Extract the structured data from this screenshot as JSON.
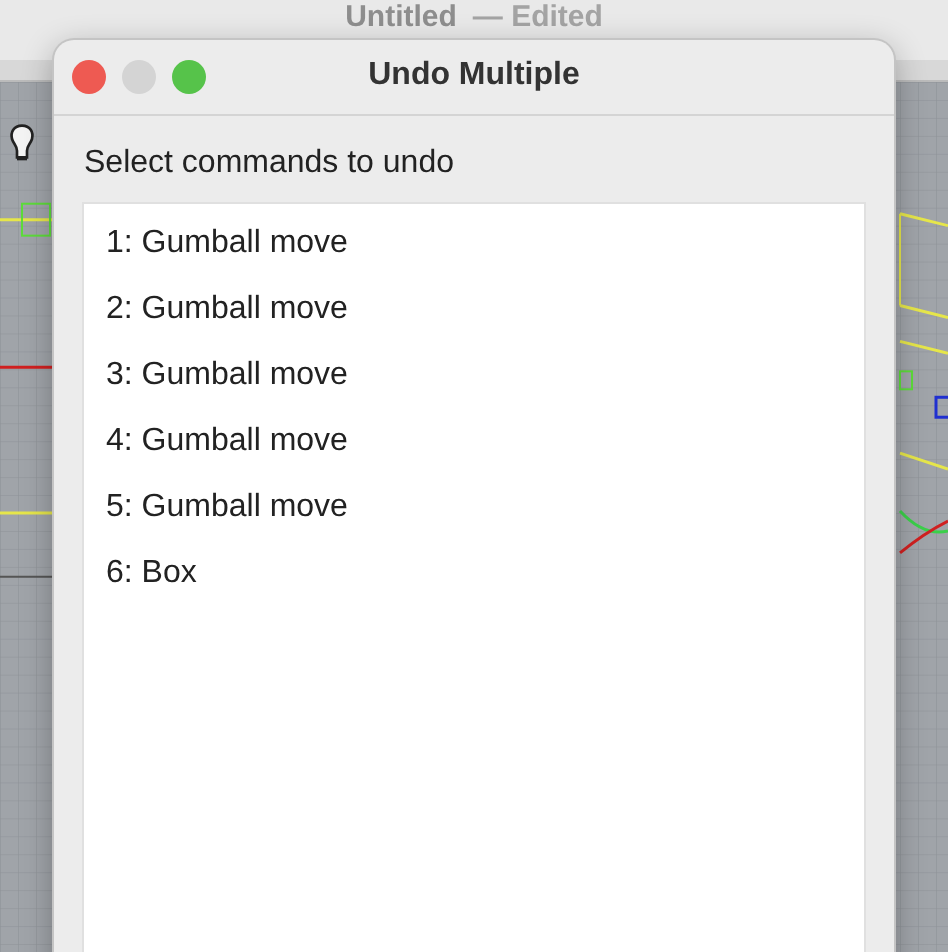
{
  "background_window": {
    "title": "Untitled",
    "status": "— Edited"
  },
  "dialog": {
    "title": "Undo Multiple",
    "prompt": "Select commands to undo",
    "commands": [
      "1: Gumball move",
      "2: Gumball move",
      "3: Gumball move",
      "4: Gumball move",
      "5: Gumball move",
      "6: Box"
    ]
  }
}
